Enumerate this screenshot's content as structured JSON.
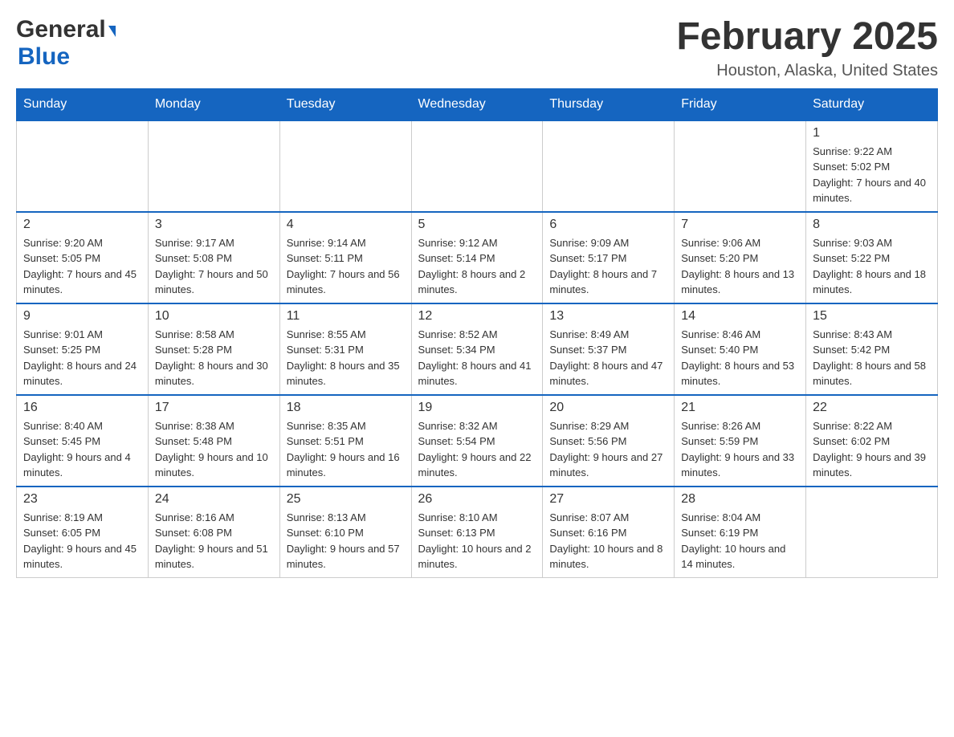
{
  "header": {
    "logo": {
      "general": "General",
      "arrow": "▶",
      "blue": "Blue"
    },
    "title": "February 2025",
    "location": "Houston, Alaska, United States"
  },
  "days_of_week": [
    "Sunday",
    "Monday",
    "Tuesday",
    "Wednesday",
    "Thursday",
    "Friday",
    "Saturday"
  ],
  "weeks": [
    [
      {
        "day": "",
        "info": ""
      },
      {
        "day": "",
        "info": ""
      },
      {
        "day": "",
        "info": ""
      },
      {
        "day": "",
        "info": ""
      },
      {
        "day": "",
        "info": ""
      },
      {
        "day": "",
        "info": ""
      },
      {
        "day": "1",
        "info": "Sunrise: 9:22 AM\nSunset: 5:02 PM\nDaylight: 7 hours and 40 minutes."
      }
    ],
    [
      {
        "day": "2",
        "info": "Sunrise: 9:20 AM\nSunset: 5:05 PM\nDaylight: 7 hours and 45 minutes."
      },
      {
        "day": "3",
        "info": "Sunrise: 9:17 AM\nSunset: 5:08 PM\nDaylight: 7 hours and 50 minutes."
      },
      {
        "day": "4",
        "info": "Sunrise: 9:14 AM\nSunset: 5:11 PM\nDaylight: 7 hours and 56 minutes."
      },
      {
        "day": "5",
        "info": "Sunrise: 9:12 AM\nSunset: 5:14 PM\nDaylight: 8 hours and 2 minutes."
      },
      {
        "day": "6",
        "info": "Sunrise: 9:09 AM\nSunset: 5:17 PM\nDaylight: 8 hours and 7 minutes."
      },
      {
        "day": "7",
        "info": "Sunrise: 9:06 AM\nSunset: 5:20 PM\nDaylight: 8 hours and 13 minutes."
      },
      {
        "day": "8",
        "info": "Sunrise: 9:03 AM\nSunset: 5:22 PM\nDaylight: 8 hours and 18 minutes."
      }
    ],
    [
      {
        "day": "9",
        "info": "Sunrise: 9:01 AM\nSunset: 5:25 PM\nDaylight: 8 hours and 24 minutes."
      },
      {
        "day": "10",
        "info": "Sunrise: 8:58 AM\nSunset: 5:28 PM\nDaylight: 8 hours and 30 minutes."
      },
      {
        "day": "11",
        "info": "Sunrise: 8:55 AM\nSunset: 5:31 PM\nDaylight: 8 hours and 35 minutes."
      },
      {
        "day": "12",
        "info": "Sunrise: 8:52 AM\nSunset: 5:34 PM\nDaylight: 8 hours and 41 minutes."
      },
      {
        "day": "13",
        "info": "Sunrise: 8:49 AM\nSunset: 5:37 PM\nDaylight: 8 hours and 47 minutes."
      },
      {
        "day": "14",
        "info": "Sunrise: 8:46 AM\nSunset: 5:40 PM\nDaylight: 8 hours and 53 minutes."
      },
      {
        "day": "15",
        "info": "Sunrise: 8:43 AM\nSunset: 5:42 PM\nDaylight: 8 hours and 58 minutes."
      }
    ],
    [
      {
        "day": "16",
        "info": "Sunrise: 8:40 AM\nSunset: 5:45 PM\nDaylight: 9 hours and 4 minutes."
      },
      {
        "day": "17",
        "info": "Sunrise: 8:38 AM\nSunset: 5:48 PM\nDaylight: 9 hours and 10 minutes."
      },
      {
        "day": "18",
        "info": "Sunrise: 8:35 AM\nSunset: 5:51 PM\nDaylight: 9 hours and 16 minutes."
      },
      {
        "day": "19",
        "info": "Sunrise: 8:32 AM\nSunset: 5:54 PM\nDaylight: 9 hours and 22 minutes."
      },
      {
        "day": "20",
        "info": "Sunrise: 8:29 AM\nSunset: 5:56 PM\nDaylight: 9 hours and 27 minutes."
      },
      {
        "day": "21",
        "info": "Sunrise: 8:26 AM\nSunset: 5:59 PM\nDaylight: 9 hours and 33 minutes."
      },
      {
        "day": "22",
        "info": "Sunrise: 8:22 AM\nSunset: 6:02 PM\nDaylight: 9 hours and 39 minutes."
      }
    ],
    [
      {
        "day": "23",
        "info": "Sunrise: 8:19 AM\nSunset: 6:05 PM\nDaylight: 9 hours and 45 minutes."
      },
      {
        "day": "24",
        "info": "Sunrise: 8:16 AM\nSunset: 6:08 PM\nDaylight: 9 hours and 51 minutes."
      },
      {
        "day": "25",
        "info": "Sunrise: 8:13 AM\nSunset: 6:10 PM\nDaylight: 9 hours and 57 minutes."
      },
      {
        "day": "26",
        "info": "Sunrise: 8:10 AM\nSunset: 6:13 PM\nDaylight: 10 hours and 2 minutes."
      },
      {
        "day": "27",
        "info": "Sunrise: 8:07 AM\nSunset: 6:16 PM\nDaylight: 10 hours and 8 minutes."
      },
      {
        "day": "28",
        "info": "Sunrise: 8:04 AM\nSunset: 6:19 PM\nDaylight: 10 hours and 14 minutes."
      },
      {
        "day": "",
        "info": ""
      }
    ]
  ]
}
